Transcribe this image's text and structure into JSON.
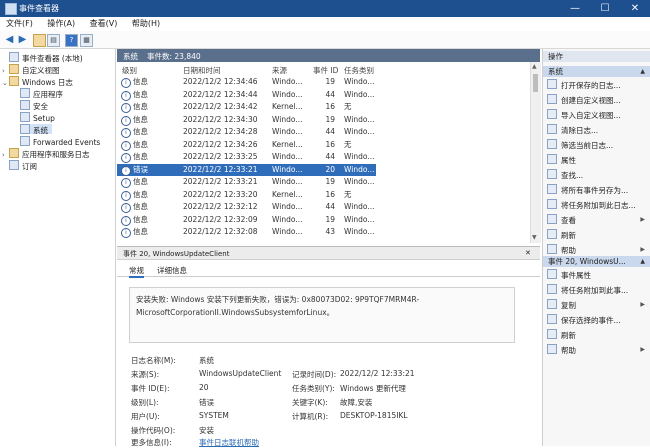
{
  "window": {
    "title": "事件查看器",
    "minimize": "—",
    "maximize": "☐",
    "close": "✕"
  },
  "menu": [
    "文件(F)",
    "操作(A)",
    "查看(V)",
    "帮助(H)"
  ],
  "tree": [
    {
      "label": "事件查看器 (本地)",
      "depth": 0,
      "twisty": ""
    },
    {
      "label": "自定义视图",
      "depth": 1,
      "twisty": "›"
    },
    {
      "label": "Windows 日志",
      "depth": 1,
      "twisty": "⌄"
    },
    {
      "label": "应用程序",
      "depth": 2,
      "twisty": ""
    },
    {
      "label": "安全",
      "depth": 2,
      "twisty": ""
    },
    {
      "label": "Setup",
      "depth": 2,
      "twisty": ""
    },
    {
      "label": "系统",
      "depth": 2,
      "twisty": "",
      "selected": true
    },
    {
      "label": "Forwarded Events",
      "depth": 2,
      "twisty": ""
    },
    {
      "label": "应用程序和服务日志",
      "depth": 1,
      "twisty": "›"
    },
    {
      "label": "订阅",
      "depth": 1,
      "twisty": ""
    }
  ],
  "list_header": {
    "log_name": "系统",
    "count_label": "事件数: 23,840"
  },
  "columns": [
    "级别",
    "日期和时间",
    "来源",
    "事件 ID",
    "任务类别"
  ],
  "rows": [
    {
      "level": "信息",
      "date": "2022/12/2 12:34:46",
      "source": "Windo...",
      "id": "19",
      "task": "Windo..."
    },
    {
      "level": "信息",
      "date": "2022/12/2 12:34:44",
      "source": "Windo...",
      "id": "44",
      "task": "Windo..."
    },
    {
      "level": "信息",
      "date": "2022/12/2 12:34:42",
      "source": "Kernel...",
      "id": "16",
      "task": "无"
    },
    {
      "level": "信息",
      "date": "2022/12/2 12:34:30",
      "source": "Windo...",
      "id": "19",
      "task": "Windo..."
    },
    {
      "level": "信息",
      "date": "2022/12/2 12:34:28",
      "source": "Windo...",
      "id": "44",
      "task": "Windo..."
    },
    {
      "level": "信息",
      "date": "2022/12/2 12:34:26",
      "source": "Kernel...",
      "id": "16",
      "task": "无"
    },
    {
      "level": "信息",
      "date": "2022/12/2 12:33:25",
      "source": "Windo...",
      "id": "44",
      "task": "Windo..."
    },
    {
      "level": "错误",
      "date": "2022/12/2 12:33:21",
      "source": "Windo...",
      "id": "20",
      "task": "Windo...",
      "selected": true
    },
    {
      "level": "信息",
      "date": "2022/12/2 12:33:21",
      "source": "Windo...",
      "id": "19",
      "task": "Windo..."
    },
    {
      "level": "信息",
      "date": "2022/12/2 12:33:20",
      "source": "Kernel...",
      "id": "16",
      "task": "无"
    },
    {
      "level": "信息",
      "date": "2022/12/2 12:32:12",
      "source": "Windo...",
      "id": "44",
      "task": "Windo..."
    },
    {
      "level": "信息",
      "date": "2022/12/2 12:32:09",
      "source": "Windo...",
      "id": "19",
      "task": "Windo..."
    },
    {
      "level": "信息",
      "date": "2022/12/2 12:32:08",
      "source": "Windo...",
      "id": "43",
      "task": "Windo..."
    }
  ],
  "detail": {
    "header": "事件 20, WindowsUpdateClient",
    "close": "✕",
    "tabs": [
      "常规",
      "详细信息"
    ],
    "message_line1": "安装失败: Windows 安装下列更新失败，错误为: 0x80073D02: 9P9TQF7MRM4R-",
    "message_line2": "MicrosoftCorporationII.WindowsSubsystemforLinux。",
    "fields": {
      "log_name_label": "日志名称(M):",
      "log_name": "系统",
      "source_label": "来源(S):",
      "source": "WindowsUpdateClient",
      "logged_label": "记录时间(D):",
      "logged": "2022/12/2 12:33:21",
      "event_id_label": "事件 ID(E):",
      "event_id": "20",
      "task_label": "任务类别(Y):",
      "task": "Windows 更新代理",
      "level_label": "级别(L):",
      "level": "错误",
      "keywords_label": "关键字(K):",
      "keywords": "故障,安装",
      "user_label": "用户(U):",
      "user": "SYSTEM",
      "computer_label": "计算机(R):",
      "computer": "DESKTOP-1815IKL",
      "opcode_label": "操作代码(O):",
      "opcode": "安装",
      "more_label": "更多信息(I):",
      "more_link": "事件日志联机帮助"
    }
  },
  "actions": {
    "title": "操作",
    "section1": "系统",
    "items1": [
      {
        "label": "打开保存的日志...",
        "arrow": ""
      },
      {
        "label": "创建自定义视图...",
        "arrow": ""
      },
      {
        "label": "导入自定义视图...",
        "arrow": ""
      },
      {
        "label": "清除日志...",
        "arrow": ""
      },
      {
        "label": "筛选当前日志...",
        "arrow": ""
      },
      {
        "label": "属性",
        "arrow": ""
      },
      {
        "label": "查找...",
        "arrow": ""
      },
      {
        "label": "将所有事件另存为...",
        "arrow": ""
      },
      {
        "label": "将任务附加到此日志...",
        "arrow": ""
      },
      {
        "label": "查看",
        "arrow": "▶"
      },
      {
        "label": "刷新",
        "arrow": ""
      },
      {
        "label": "帮助",
        "arrow": "▶"
      }
    ],
    "section2": "事件 20, WindowsU...",
    "items2": [
      {
        "label": "事件属性",
        "arrow": ""
      },
      {
        "label": "将任务附加到此事...",
        "arrow": ""
      },
      {
        "label": "复制",
        "arrow": "▶"
      },
      {
        "label": "保存选择的事件...",
        "arrow": ""
      },
      {
        "label": "刷新",
        "arrow": ""
      },
      {
        "label": "帮助",
        "arrow": "▶"
      }
    ]
  }
}
